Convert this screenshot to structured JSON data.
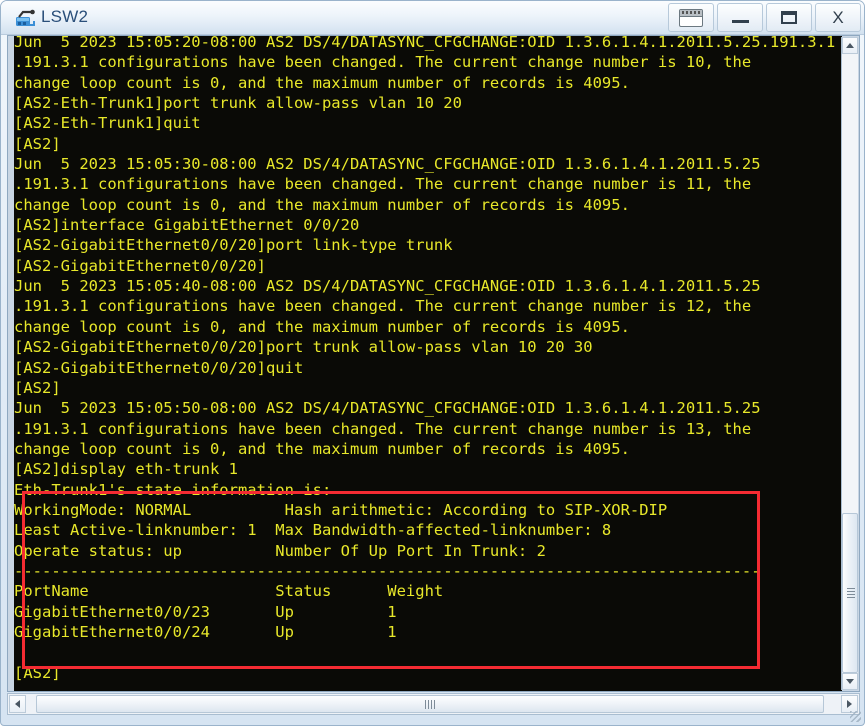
{
  "window": {
    "title": "LSW2",
    "icon": "switch-icon",
    "buttons": {
      "keyboard_label": "",
      "minimize_label": "",
      "maximize_label": "",
      "close_label": "X"
    }
  },
  "terminal": {
    "text_color": "#e8e82a",
    "background_color": "#0a0a06",
    "lines": [
      "Jun  5 2023 15:05:20-08:00 AS2 DS/4/DATASYNC_CFGCHANGE:OID 1.3.6.1.4.1.2011.5.25.191.3.1 configurations have been changed. The current change number is 10, the",
      ".191.3.1 configurations have been changed. The current change number is 10, the",
      "change loop count is 0, and the maximum number of records is 4095.",
      "[AS2-Eth-Trunk1]port trunk allow-pass vlan 10 20",
      "[AS2-Eth-Trunk1]quit",
      "[AS2]",
      "Jun  5 2023 15:05:30-08:00 AS2 DS/4/DATASYNC_CFGCHANGE:OID 1.3.6.1.4.1.2011.5.25",
      ".191.3.1 configurations have been changed. The current change number is 11, the",
      "change loop count is 0, and the maximum number of records is 4095.",
      "[AS2]interface GigabitEthernet 0/0/20",
      "[AS2-GigabitEthernet0/0/20]port link-type trunk",
      "[AS2-GigabitEthernet0/0/20]",
      "Jun  5 2023 15:05:40-08:00 AS2 DS/4/DATASYNC_CFGCHANGE:OID 1.3.6.1.4.1.2011.5.25",
      ".191.3.1 configurations have been changed. The current change number is 12, the",
      "change loop count is 0, and the maximum number of records is 4095.",
      "[AS2-GigabitEthernet0/0/20]port trunk allow-pass vlan 10 20 30",
      "[AS2-GigabitEthernet0/0/20]quit",
      "[AS2]",
      "Jun  5 2023 15:05:50-08:00 AS2 DS/4/DATASYNC_CFGCHANGE:OID 1.3.6.1.4.1.2011.5.25",
      ".191.3.1 configurations have been changed. The current change number is 13, the",
      "change loop count is 0, and the maximum number of records is 4095.",
      "[AS2]display eth-trunk 1",
      "Eth-Trunk1's state information is:",
      "WorkingMode: NORMAL          Hash arithmetic: According to SIP-XOR-DIP",
      "Least Active-linknumber: 1  Max Bandwidth-affected-linknumber: 8",
      "Operate status: up          Number Of Up Port In Trunk: 2",
      "--------------------------------------------------------------------------------",
      "PortName                    Status      Weight",
      "GigabitEthernet0/0/23       Up          1",
      "GigabitEthernet0/0/24       Up          1",
      "",
      "[AS2]"
    ]
  },
  "highlight": {
    "name": "eth-trunk-output-highlight",
    "color": "#f42b32"
  },
  "eth_trunk_detail": {
    "header": "Eth-Trunk1's state information is:",
    "working_mode_label": "WorkingMode:",
    "working_mode_value": "NORMAL",
    "hash_label": "Hash arithmetic:",
    "hash_value": "According to SIP-XOR-DIP",
    "least_active_label": "Least Active-linknumber:",
    "least_active_value": "1",
    "max_bw_label": "Max Bandwidth-affected-linknumber:",
    "max_bw_value": "8",
    "operate_status_label": "Operate status:",
    "operate_status_value": "up",
    "up_port_label": "Number Of Up Port In Trunk:",
    "up_port_value": "2",
    "table_headers": [
      "PortName",
      "Status",
      "Weight"
    ],
    "table_rows": [
      [
        "GigabitEthernet0/0/23",
        "Up",
        "1"
      ],
      [
        "GigabitEthernet0/0/24",
        "Up",
        "1"
      ]
    ]
  },
  "scrollbars": {
    "vertical": {
      "up_arrow": "▲",
      "down_arrow": "▼"
    },
    "horizontal": {
      "left_arrow": "◀",
      "right_arrow": "▶"
    }
  }
}
